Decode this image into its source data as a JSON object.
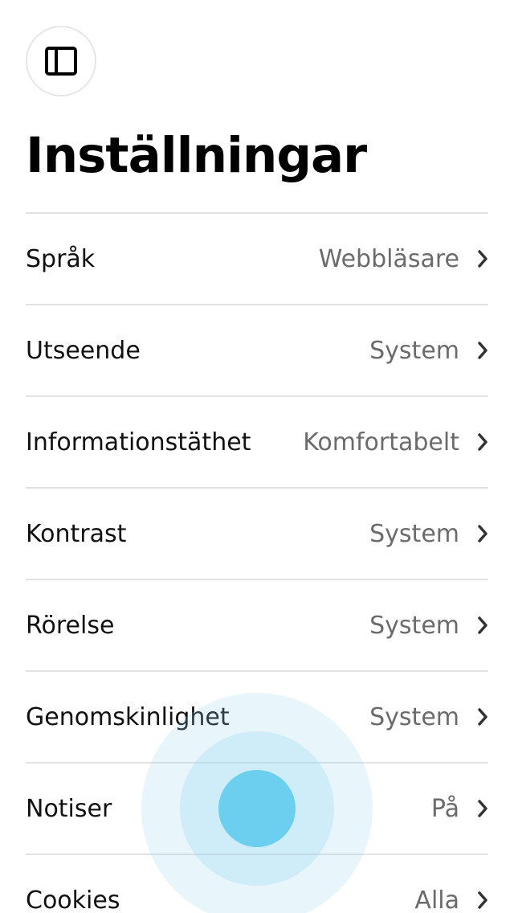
{
  "header": {
    "sidebar_toggle_icon": "sidebar-panel-icon"
  },
  "page": {
    "title": "Inställningar"
  },
  "settings": [
    {
      "label": "Språk",
      "value": "Webbläsare"
    },
    {
      "label": "Utseende",
      "value": "System"
    },
    {
      "label": "Informationstäthet",
      "value": "Komfortabelt"
    },
    {
      "label": "Kontrast",
      "value": "System"
    },
    {
      "label": "Rörelse",
      "value": "System"
    },
    {
      "label": "Genomskinlighet",
      "value": "System"
    },
    {
      "label": "Notiser",
      "value": "På"
    },
    {
      "label": "Cookies",
      "value": "Alla"
    }
  ],
  "icons": {
    "chevron": "chevron-right-icon"
  },
  "colors": {
    "touch_indicator": "#6ccfef",
    "divider": "#e2e2e2",
    "value_text": "#6b6b6b"
  }
}
